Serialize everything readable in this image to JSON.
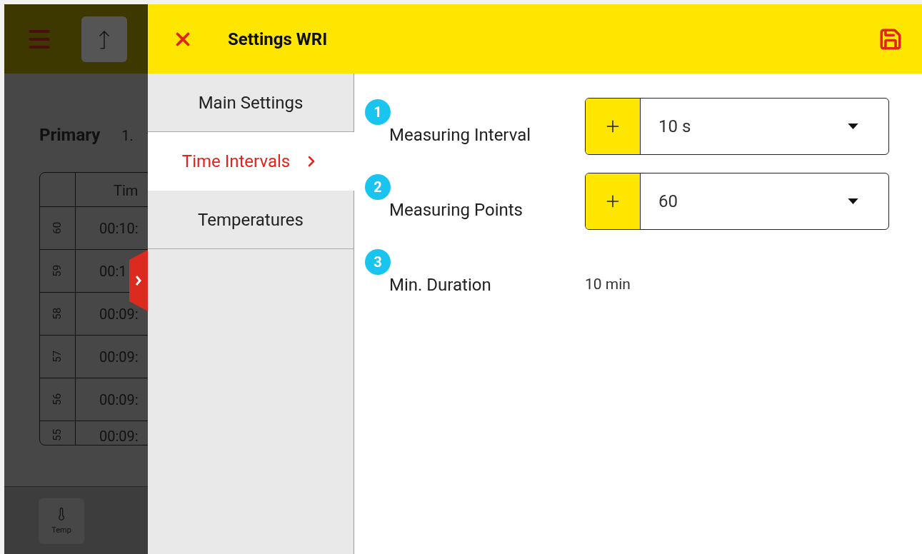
{
  "background_app": {
    "title": "Primary",
    "value": "1.",
    "table": {
      "columns": [
        "",
        "Tim"
      ],
      "rows": [
        {
          "index": "60",
          "time": "00:10:"
        },
        {
          "index": "59",
          "time": "00:1"
        },
        {
          "index": "58",
          "time": "00:09:"
        },
        {
          "index": "57",
          "time": "00:09:"
        },
        {
          "index": "56",
          "time": "00:09:"
        },
        {
          "index": "55",
          "time": "00:09:"
        }
      ]
    },
    "bottom_nav": [
      {
        "label": "Temp"
      }
    ]
  },
  "settings_panel": {
    "title": "Settings WRI",
    "nav": [
      {
        "label": "Main Settings",
        "selected": false
      },
      {
        "label": "Time Intervals",
        "selected": true
      },
      {
        "label": "Temperatures",
        "selected": false
      }
    ],
    "fields": [
      {
        "number": "1",
        "label": "Measuring Interval",
        "kind": "select",
        "value": "10 s"
      },
      {
        "number": "2",
        "label": "Measuring Points",
        "kind": "select",
        "value": "60"
      },
      {
        "number": "3",
        "label": "Min. Duration",
        "kind": "text",
        "value": "10 min"
      }
    ]
  }
}
